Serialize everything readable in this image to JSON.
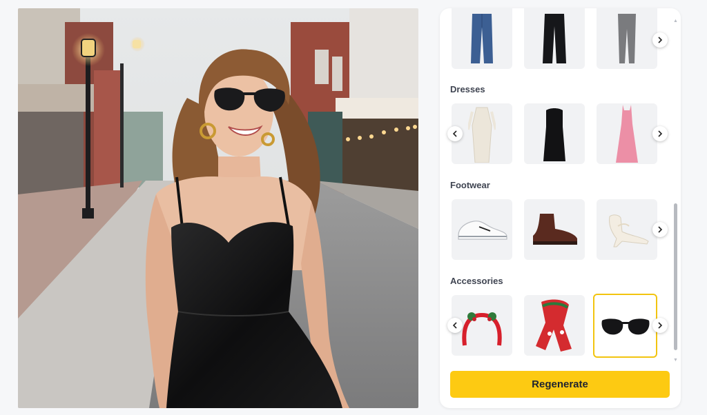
{
  "app": {
    "preview": {
      "description_icon": "fashion-photo"
    },
    "panel": {
      "sections": [
        {
          "id": "bottoms",
          "title": "",
          "items": [
            {
              "icon": "blue-jeans"
            },
            {
              "icon": "black-trousers"
            },
            {
              "icon": "grey-leggings"
            }
          ]
        },
        {
          "id": "dresses",
          "title": "Dresses",
          "items": [
            {
              "icon": "white-lace-dress"
            },
            {
              "icon": "black-strapless-dress"
            },
            {
              "icon": "pink-maxi-dress"
            }
          ]
        },
        {
          "id": "footwear",
          "title": "Footwear",
          "items": [
            {
              "icon": "white-sneaker"
            },
            {
              "icon": "brown-chelsea-boot"
            },
            {
              "icon": "white-strappy-heel"
            }
          ]
        },
        {
          "id": "accessories",
          "title": "Accessories",
          "items": [
            {
              "icon": "christmas-headband"
            },
            {
              "icon": "christmas-scarf"
            },
            {
              "icon": "black-sunglasses",
              "selected": true
            }
          ]
        }
      ],
      "regenerate_label": "Regenerate"
    },
    "colors": {
      "accent": "#fdca12",
      "selected_border": "#f2c40f",
      "panel_bg": "#ffffff",
      "page_bg": "#f6f7f9"
    }
  }
}
